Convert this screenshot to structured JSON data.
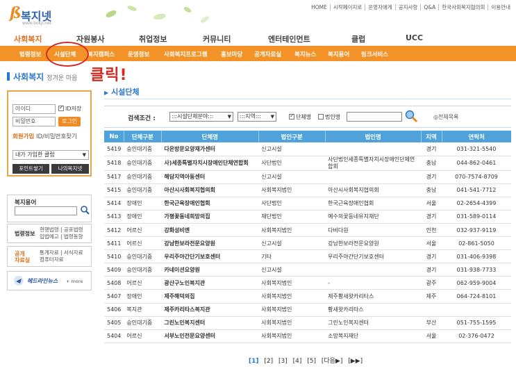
{
  "logo": {
    "name": "복지넷",
    "sub": "www.bokji.net"
  },
  "toplinks": [
    "HOME",
    "시작페이지로",
    "운영자에게",
    "공지사항",
    "Q&A",
    "한국사회복지협의회",
    "이용안내"
  ],
  "mainnav": [
    "사회복지",
    "자원봉사",
    "취업정보",
    "커뮤니티",
    "엔터테인먼트",
    "클럽",
    "UCC"
  ],
  "subnav": [
    "법령정보",
    "시설단체",
    "복지캠퍼스",
    "운영정보",
    "사회복지프로그램",
    "홍보마당",
    "공개자료실",
    "복지뉴스",
    "복지용어",
    "링크서비스"
  ],
  "annotation": "클릭!",
  "section": {
    "title": "사회복지",
    "tagline": "정겨운 마음"
  },
  "login": {
    "id_placeholder": "아이디",
    "pw_placeholder": "비밀번호",
    "save_label": "ID저장",
    "login_button": "로그인",
    "join_label": "회원가입",
    "find_label": "ID/비밀번호찾기",
    "club_select": "내가 가입한 클럽",
    "point_button": "포인트쌓기",
    "mynet_button": "나의복지넷"
  },
  "widgets": {
    "glossary": "복지용어",
    "law_title": "법령정보",
    "law_links": [
      "현행법령 | 공포법령",
      "입법예고 | 법령동향"
    ],
    "public_title": [
      "공개",
      "자료실"
    ],
    "public_links": [
      "통계자료 | 서식자료",
      "컴퓨터자료"
    ],
    "helpline": "헤드라인뉴스",
    "helpline_more": "+ more"
  },
  "content": {
    "title": "시설단체",
    "filter": {
      "label": "검색조건 :",
      "field_select": ":::시설단체분야:::",
      "region_select": ":::지역:::",
      "cb_name": "단체명",
      "cb_corp": "법인명",
      "view_all": "◎전체목록"
    },
    "columns": [
      "No",
      "단체구분",
      "단체명",
      "법인구분",
      "법인명",
      "지역",
      "연락처"
    ],
    "rows": [
      [
        "5419",
        "승인대기중",
        "다온방문요양재가센터",
        "신고시설",
        "",
        "경기",
        "031-321-5540"
      ],
      [
        "5418",
        "승인대기중",
        "사)세종특별자치시장애인단체연합회",
        "사단법인",
        "사단법인세종특별자치시장애인단체연합회",
        "충남",
        "044-862-0461"
      ],
      [
        "5417",
        "승인대기중",
        "해담지역아동센터",
        "신고시설",
        "",
        "경기",
        "070-7574-8709"
      ],
      [
        "5415",
        "승인대기중",
        "아산시사회복지협의회",
        "사회복지법인",
        "아산시사회복지협의회",
        "충남",
        "041-541-7712"
      ],
      [
        "5414",
        "장애인",
        "한국근육장애인협회",
        "사단법인",
        "한국근육장애인협회",
        "서울",
        "02-2654-4399"
      ],
      [
        "5413",
        "장애인",
        "가평꽃동네희망의집",
        "재단법인",
        "예수의꽃동네유지재단",
        "경기",
        "031-589-0114"
      ],
      [
        "5412",
        "어르신",
        "강화성비엔",
        "사회복지법인",
        "다비다원",
        "인천",
        "032-937-9119"
      ],
      [
        "5411",
        "어르신",
        "강남한보라전문요양원",
        "신고시설",
        "강남한보라전문요양원",
        "서울",
        "02-861-5050"
      ],
      [
        "5410",
        "승인대기중",
        "우리주야간단기보호센터",
        "기타",
        "우리주야간단기보호센터",
        "경기",
        "031-406-9398"
      ],
      [
        "5409",
        "승인대기중",
        "카네이션요양원",
        "신고시설",
        "",
        "경기",
        "031-938-7733"
      ],
      [
        "5408",
        "어르신",
        "광산구노인복지관",
        "사회복지법인",
        "-",
        "광주",
        "062-959-9004"
      ],
      [
        "5407",
        "장애인",
        "제주해덕의집",
        "사회복지법인",
        "제주황새왓카리타스",
        "제주",
        "064-724-8101"
      ],
      [
        "5406",
        "복지관",
        "제주카리타스복지관",
        "사회복지법인",
        "황새왓카리타스",
        "",
        ""
      ],
      [
        "5405",
        "승인대기중",
        "그린노인복지센터",
        "사회복지법인",
        "그린노인복지센터",
        "부산",
        "051-755-1595"
      ],
      [
        "5404",
        "어르신",
        "서부노인전문요양센터",
        "사회복지법인",
        "소망복지재단",
        "서울",
        "02-376-0472"
      ]
    ],
    "pager": {
      "current": "[1]",
      "pages": [
        "[2]",
        "[3]",
        "[4]",
        "[5]"
      ],
      "next": "[다음▶]",
      "last": "[▶▶]"
    }
  },
  "colors": {
    "accent_orange": "#f39327",
    "brand_blue": "#2a77c9",
    "header_blue": "#4fa3da",
    "annotation_red": "#d42a22"
  }
}
